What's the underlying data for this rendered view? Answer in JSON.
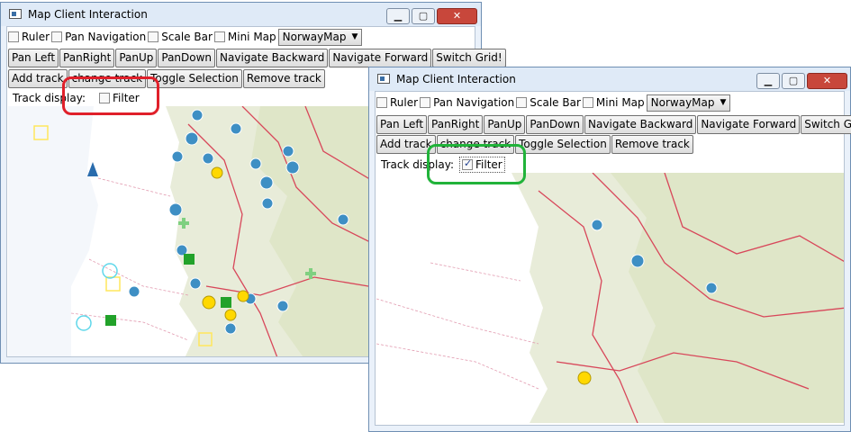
{
  "left_window": {
    "title": "Map Client Interaction",
    "toolbar1": {
      "ruler": "Ruler",
      "pan_navigation": "Pan Navigation",
      "scale_bar": "Scale Bar",
      "mini_map": "Mini Map",
      "map_select": "NorwayMap"
    },
    "toolbar2": [
      "Pan Left",
      "PanRight",
      "PanUp",
      "PanDown",
      "Navigate Backward",
      "Navigate Forward",
      "Switch Grid!"
    ],
    "toolbar3": [
      "Add track",
      "change track",
      "Toggle Selection",
      "Remove track"
    ],
    "track_display": {
      "label": "Track display:",
      "filter": "Filter",
      "filter_checked": false
    }
  },
  "right_window": {
    "title": "Map Client Interaction",
    "toolbar1": {
      "ruler": "Ruler",
      "pan_navigation": "Pan Navigation",
      "scale_bar": "Scale Bar",
      "mini_map": "Mini Map",
      "map_select": "NorwayMap"
    },
    "toolbar2": [
      "Pan Left",
      "PanRight",
      "PanUp",
      "PanDown",
      "Navigate Backward",
      "Navigate Forward",
      "Switch Grid!"
    ],
    "toolbar3": [
      "Add track",
      "change track",
      "Toggle Selection",
      "Remove track"
    ],
    "track_display": {
      "label": "Track display:",
      "filter": "Filter",
      "filter_checked": true
    }
  },
  "icons": {
    "minimize": "minimize-icon",
    "maximize": "maximize-icon",
    "close": "close-icon",
    "app": "app-window-icon"
  },
  "colors": {
    "highlight_red": "#e0202a",
    "highlight_green": "#21b33a",
    "water": "#ffffff",
    "land": "#e7ead8",
    "roads": "#d8475a"
  }
}
